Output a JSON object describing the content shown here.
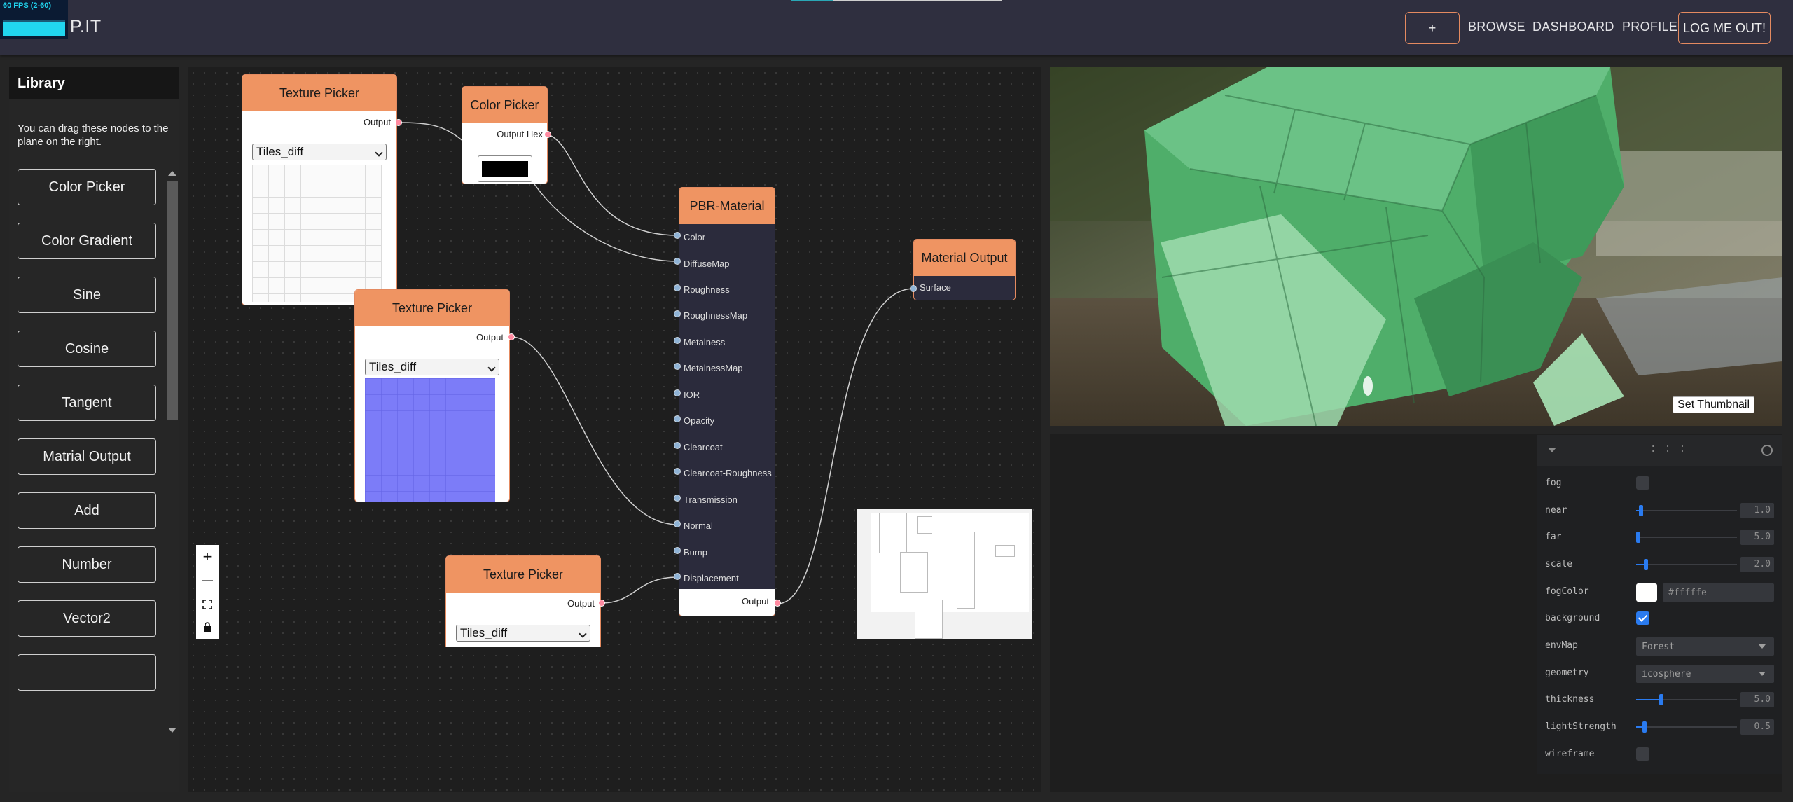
{
  "fps": {
    "text": "60 FPS (2-60)"
  },
  "app": {
    "logo_text": "P.IT"
  },
  "nav": {
    "plus": "+",
    "browse": "BROWSE",
    "dashboard": "DASHBOARD",
    "profile": "PROFILE",
    "logout": "LOG ME OUT!"
  },
  "library": {
    "title": "Library",
    "help": "You can drag these nodes to the plane on the right.",
    "items": [
      "Color Picker",
      "Color Gradient",
      "Sine",
      "Cosine",
      "Tangent",
      "Matrial Output",
      "Add",
      "Number",
      "Vector2"
    ]
  },
  "nodes": {
    "texture1": {
      "title": "Texture Picker",
      "output": "Output",
      "select": "Tiles_diff"
    },
    "texture2": {
      "title": "Texture Picker",
      "output": "Output",
      "select": "Tiles_diff"
    },
    "texture3": {
      "title": "Texture Picker",
      "output": "Output",
      "select": "Tiles_diff"
    },
    "color": {
      "title": "Color Picker",
      "output": "Output Hex",
      "value": "#000000"
    },
    "pbr": {
      "title": "PBR-Material",
      "inputs": [
        "Color",
        "DiffuseMap",
        "Roughness",
        "RoughnessMap",
        "Metalness",
        "MetalnessMap",
        "IOR",
        "Opacity",
        "Clearcoat",
        "Clearcoat-Roughness",
        "Transmission",
        "Normal",
        "Bump",
        "Displacement"
      ],
      "output": "Output"
    },
    "matout": {
      "title": "Material Output",
      "input": "Surface"
    }
  },
  "zoom_controls": {
    "zoom_in": "+",
    "zoom_out": "—"
  },
  "viewport": {
    "set_thumbnail": "Set Thumbnail"
  },
  "gui": {
    "fog": {
      "label": "fog",
      "checked": false
    },
    "near": {
      "label": "near",
      "value": "1.0",
      "fraction": 0.05
    },
    "far": {
      "label": "far",
      "value": "5.0",
      "fraction": 0.0
    },
    "scale": {
      "label": "scale",
      "value": "2.0",
      "fraction": 0.1
    },
    "fogColor": {
      "label": "fogColor",
      "value": "#fffffe"
    },
    "background": {
      "label": "background",
      "checked": true
    },
    "envMap": {
      "label": "envMap",
      "value": "Forest"
    },
    "geometry": {
      "label": "geometry",
      "value": "icosphere"
    },
    "thickness": {
      "label": "thickness",
      "value": "5.0",
      "fraction": 0.25
    },
    "lightStrength": {
      "label": "lightStrength",
      "value": "0.5",
      "fraction": 0.08
    },
    "wireframe": {
      "label": "wireframe",
      "checked": false
    }
  },
  "colors": {
    "accent": "#ef9462",
    "nav_bg": "#2f2f3f",
    "gui_blue": "#2a7bf0",
    "cube_green": "#4fae6a"
  }
}
